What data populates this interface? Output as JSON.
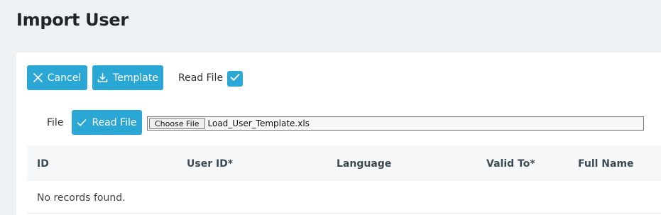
{
  "page": {
    "title": "Import User"
  },
  "toolbar": {
    "cancel_label": "Cancel",
    "cancel_icon": "close-icon",
    "template_label": "Template",
    "template_icon": "download-icon",
    "read_file_label": "Read File",
    "read_file_checked": true
  },
  "file_row": {
    "label": "File",
    "read_button_label": "Read File",
    "read_button_icon": "check-icon",
    "choose_label": "Choose File",
    "file_name": "Load_User_Template.xls"
  },
  "table": {
    "columns": [
      "ID",
      "User ID*",
      "Language",
      "Valid To*",
      "Full Name"
    ],
    "empty_message": "No records found."
  },
  "colors": {
    "accent": "#2aa7d5",
    "background": "#eff2f5",
    "card": "#ffffff"
  }
}
